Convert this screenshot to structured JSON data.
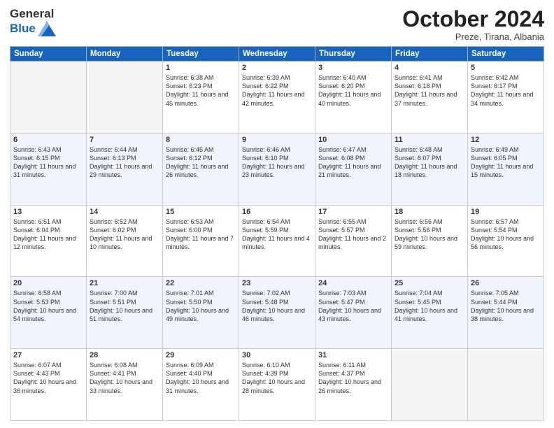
{
  "header": {
    "logo_line1": "General",
    "logo_line2": "Blue",
    "month": "October 2024",
    "location": "Preze, Tirana, Albania"
  },
  "weekdays": [
    "Sunday",
    "Monday",
    "Tuesday",
    "Wednesday",
    "Thursday",
    "Friday",
    "Saturday"
  ],
  "weeks": [
    [
      {
        "day": "",
        "text": ""
      },
      {
        "day": "",
        "text": ""
      },
      {
        "day": "1",
        "text": "Sunrise: 6:38 AM\nSunset: 6:23 PM\nDaylight: 11 hours and 45 minutes."
      },
      {
        "day": "2",
        "text": "Sunrise: 6:39 AM\nSunset: 6:22 PM\nDaylight: 11 hours and 42 minutes."
      },
      {
        "day": "3",
        "text": "Sunrise: 6:40 AM\nSunset: 6:20 PM\nDaylight: 11 hours and 40 minutes."
      },
      {
        "day": "4",
        "text": "Sunrise: 6:41 AM\nSunset: 6:18 PM\nDaylight: 11 hours and 37 minutes."
      },
      {
        "day": "5",
        "text": "Sunrise: 6:42 AM\nSunset: 6:17 PM\nDaylight: 11 hours and 34 minutes."
      }
    ],
    [
      {
        "day": "6",
        "text": "Sunrise: 6:43 AM\nSunset: 6:15 PM\nDaylight: 11 hours and 31 minutes."
      },
      {
        "day": "7",
        "text": "Sunrise: 6:44 AM\nSunset: 6:13 PM\nDaylight: 11 hours and 29 minutes."
      },
      {
        "day": "8",
        "text": "Sunrise: 6:45 AM\nSunset: 6:12 PM\nDaylight: 11 hours and 26 minutes."
      },
      {
        "day": "9",
        "text": "Sunrise: 6:46 AM\nSunset: 6:10 PM\nDaylight: 11 hours and 23 minutes."
      },
      {
        "day": "10",
        "text": "Sunrise: 6:47 AM\nSunset: 6:08 PM\nDaylight: 11 hours and 21 minutes."
      },
      {
        "day": "11",
        "text": "Sunrise: 6:48 AM\nSunset: 6:07 PM\nDaylight: 11 hours and 18 minutes."
      },
      {
        "day": "12",
        "text": "Sunrise: 6:49 AM\nSunset: 6:05 PM\nDaylight: 11 hours and 15 minutes."
      }
    ],
    [
      {
        "day": "13",
        "text": "Sunrise: 6:51 AM\nSunset: 6:04 PM\nDaylight: 11 hours and 12 minutes."
      },
      {
        "day": "14",
        "text": "Sunrise: 6:52 AM\nSunset: 6:02 PM\nDaylight: 11 hours and 10 minutes."
      },
      {
        "day": "15",
        "text": "Sunrise: 6:53 AM\nSunset: 6:00 PM\nDaylight: 11 hours and 7 minutes."
      },
      {
        "day": "16",
        "text": "Sunrise: 6:54 AM\nSunset: 5:59 PM\nDaylight: 11 hours and 4 minutes."
      },
      {
        "day": "17",
        "text": "Sunrise: 6:55 AM\nSunset: 5:57 PM\nDaylight: 11 hours and 2 minutes."
      },
      {
        "day": "18",
        "text": "Sunrise: 6:56 AM\nSunset: 5:56 PM\nDaylight: 10 hours and 59 minutes."
      },
      {
        "day": "19",
        "text": "Sunrise: 6:57 AM\nSunset: 5:54 PM\nDaylight: 10 hours and 56 minutes."
      }
    ],
    [
      {
        "day": "20",
        "text": "Sunrise: 6:58 AM\nSunset: 5:53 PM\nDaylight: 10 hours and 54 minutes."
      },
      {
        "day": "21",
        "text": "Sunrise: 7:00 AM\nSunset: 5:51 PM\nDaylight: 10 hours and 51 minutes."
      },
      {
        "day": "22",
        "text": "Sunrise: 7:01 AM\nSunset: 5:50 PM\nDaylight: 10 hours and 49 minutes."
      },
      {
        "day": "23",
        "text": "Sunrise: 7:02 AM\nSunset: 5:48 PM\nDaylight: 10 hours and 46 minutes."
      },
      {
        "day": "24",
        "text": "Sunrise: 7:03 AM\nSunset: 5:47 PM\nDaylight: 10 hours and 43 minutes."
      },
      {
        "day": "25",
        "text": "Sunrise: 7:04 AM\nSunset: 5:45 PM\nDaylight: 10 hours and 41 minutes."
      },
      {
        "day": "26",
        "text": "Sunrise: 7:05 AM\nSunset: 5:44 PM\nDaylight: 10 hours and 38 minutes."
      }
    ],
    [
      {
        "day": "27",
        "text": "Sunrise: 6:07 AM\nSunset: 4:43 PM\nDaylight: 10 hours and 36 minutes."
      },
      {
        "day": "28",
        "text": "Sunrise: 6:08 AM\nSunset: 4:41 PM\nDaylight: 10 hours and 33 minutes."
      },
      {
        "day": "29",
        "text": "Sunrise: 6:09 AM\nSunset: 4:40 PM\nDaylight: 10 hours and 31 minutes."
      },
      {
        "day": "30",
        "text": "Sunrise: 6:10 AM\nSunset: 4:39 PM\nDaylight: 10 hours and 28 minutes."
      },
      {
        "day": "31",
        "text": "Sunrise: 6:11 AM\nSunset: 4:37 PM\nDaylight: 10 hours and 26 minutes."
      },
      {
        "day": "",
        "text": ""
      },
      {
        "day": "",
        "text": ""
      }
    ]
  ]
}
